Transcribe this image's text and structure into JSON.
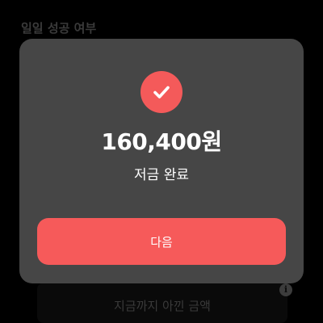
{
  "background": {
    "section_title": "일일 성공 여부",
    "saved_total_label": "지금까지 아낀 금액",
    "info_icon": "info-icon"
  },
  "modal": {
    "icon": "check-icon",
    "amount": "160,400원",
    "status": "저금 완료",
    "next_label": "다음"
  },
  "colors": {
    "accent": "#f65a5a",
    "modal_bg": "#464646",
    "page_bg": "#000000"
  }
}
